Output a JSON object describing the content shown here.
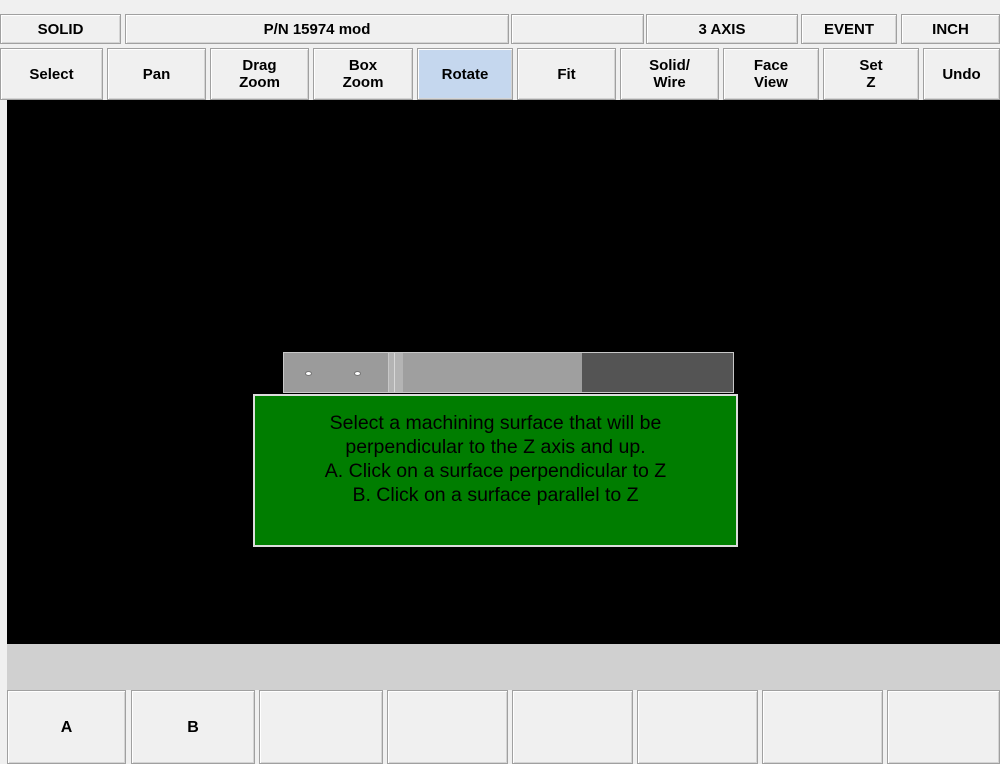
{
  "header": {
    "mode": "SOLID",
    "part_number": "P/N 15974 mod",
    "blank": "",
    "axis": "3 AXIS",
    "event": "EVENT",
    "units": "INCH"
  },
  "toolbar": {
    "select": "Select",
    "pan": "Pan",
    "drag_zoom": "Drag\nZoom",
    "box_zoom": "Box\nZoom",
    "rotate": "Rotate",
    "fit": "Fit",
    "solid_wire": "Solid/\nWire",
    "face_view": "Face\nView",
    "set_z": "Set\nZ",
    "undo": "Undo",
    "active_tool": "Rotate"
  },
  "message": {
    "lines": [
      "Select a machining surface that will be",
      "perpendicular to the Z axis and up.",
      "A. Click on a surface perpendicular to Z",
      "B. Click on a surface parallel to Z"
    ]
  },
  "function_keys": [
    "A",
    "B",
    "",
    "",
    "",
    "",
    "",
    ""
  ],
  "colors": {
    "viewport_bg": "#000000",
    "message_bg": "#007d00",
    "active_button": "#c5d7ee"
  }
}
